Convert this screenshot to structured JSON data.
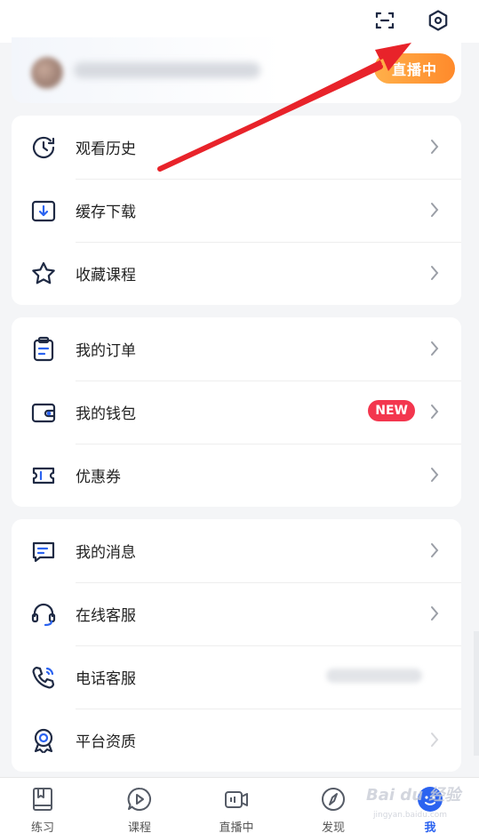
{
  "header": {
    "scan_icon": "scan-icon",
    "settings_icon": "hexagon-settings-icon"
  },
  "profile": {
    "live_label": "直播中"
  },
  "section1": {
    "items": [
      {
        "label": "观看历史",
        "icon": "clock-history-icon"
      },
      {
        "label": "缓存下载",
        "icon": "download-box-icon"
      },
      {
        "label": "收藏课程",
        "icon": "star-icon"
      }
    ]
  },
  "section2": {
    "items": [
      {
        "label": "我的订单",
        "icon": "clipboard-icon"
      },
      {
        "label": "我的钱包",
        "icon": "wallet-icon",
        "badge": "NEW"
      },
      {
        "label": "优惠券",
        "icon": "ticket-icon"
      }
    ]
  },
  "section3": {
    "items": [
      {
        "label": "我的消息",
        "icon": "message-icon"
      },
      {
        "label": "在线客服",
        "icon": "headset-icon"
      },
      {
        "label": "电话客服",
        "icon": "phone-icon"
      },
      {
        "label": "平台资质",
        "icon": "badge-ribbon-icon"
      }
    ]
  },
  "tabbar": {
    "tabs": [
      {
        "label": "练习",
        "icon": "book-icon"
      },
      {
        "label": "课程",
        "icon": "play-chat-icon"
      },
      {
        "label": "直播中",
        "icon": "live-camera-icon"
      },
      {
        "label": "发现",
        "icon": "compass-icon"
      },
      {
        "label": "我",
        "icon": "user-face-icon",
        "active": true
      }
    ]
  },
  "watermark": {
    "text": "Bai du 经验",
    "sub": "jingyan.baidu.com"
  },
  "colors": {
    "accent": "#2b63f0",
    "live": "#ff8a2b",
    "badge": "#f3364e",
    "arrow": "#e8232a"
  }
}
